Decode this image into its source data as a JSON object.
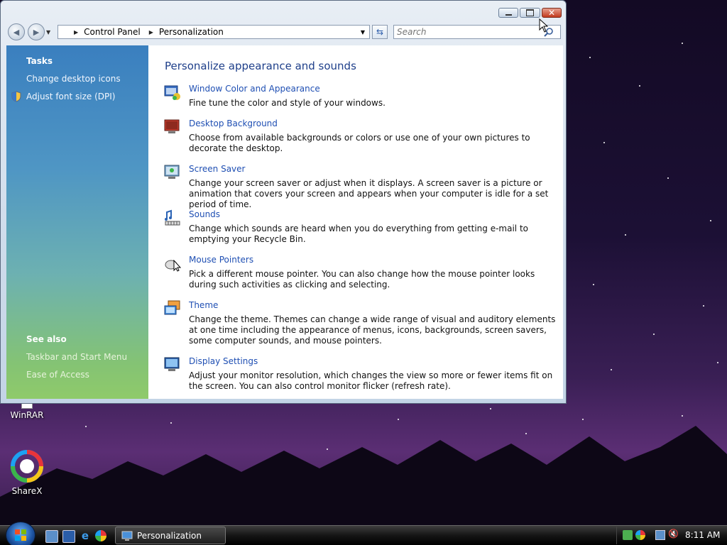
{
  "window": {
    "breadcrumb": [
      "Control Panel",
      "Personalization"
    ],
    "search_placeholder": "Search"
  },
  "sidebar": {
    "tasks_heading": "Tasks",
    "tasks": [
      "Change desktop icons",
      "Adjust font size (DPI)"
    ],
    "see_also_heading": "See also",
    "see_also": [
      "Taskbar and Start Menu",
      "Ease of Access"
    ]
  },
  "content": {
    "heading": "Personalize appearance and sounds",
    "items": [
      {
        "title": "Window Color and Appearance",
        "desc": "Fine tune the color and style of your windows.",
        "icon": "window-color-icon"
      },
      {
        "title": "Desktop Background",
        "desc": "Choose from available backgrounds or colors or use one of your own pictures to decorate the desktop.",
        "icon": "desktop-background-icon"
      },
      {
        "title": "Screen Saver",
        "desc": "Change your screen saver or adjust when it displays. A screen saver is a picture or animation that covers your screen and appears when your computer is idle for a set period of time.",
        "icon": "screen-saver-icon"
      },
      {
        "title": "Sounds",
        "desc": "Change which sounds are heard when you do everything from getting e-mail to emptying your Recycle Bin.",
        "icon": "sounds-icon"
      },
      {
        "title": "Mouse Pointers",
        "desc": "Pick a different mouse pointer. You can also change how the mouse pointer looks during such activities as clicking and selecting.",
        "icon": "mouse-pointers-icon"
      },
      {
        "title": "Theme",
        "desc": "Change the theme. Themes can change a wide range of visual and auditory elements at one time including the appearance of menus, icons, backgrounds, screen savers, some computer sounds, and mouse pointers.",
        "icon": "theme-icon"
      },
      {
        "title": "Display Settings",
        "desc": "Adjust your monitor resolution, which changes the view so more or fewer items fit on the screen. You can also control monitor flicker (refresh rate).",
        "icon": "display-settings-icon"
      }
    ]
  },
  "desktop_icons": [
    "WinRAR",
    "ShareX"
  ],
  "taskbar": {
    "task_label": "Personalization",
    "clock": "8:11 AM"
  }
}
